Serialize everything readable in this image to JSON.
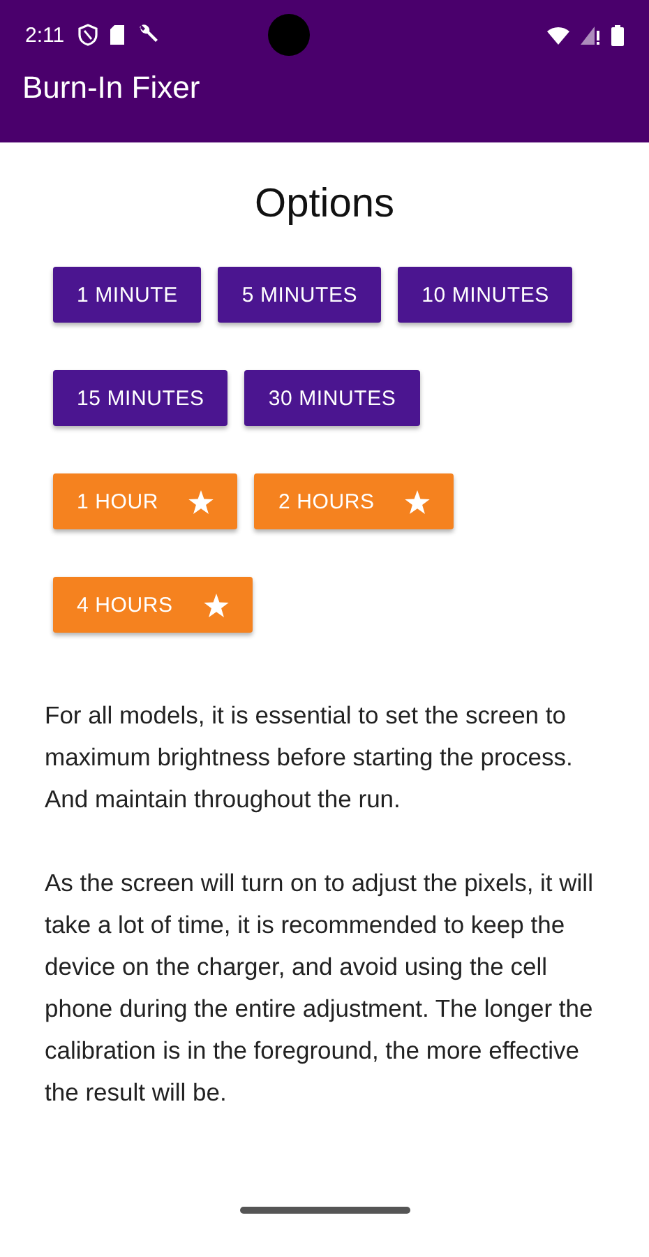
{
  "status_bar": {
    "time": "2:11"
  },
  "app_bar": {
    "title": "Burn-In Fixer"
  },
  "heading": "Options",
  "buttons": [
    {
      "label": "1 MINUTE",
      "kind": "standard"
    },
    {
      "label": "5 MINUTES",
      "kind": "standard"
    },
    {
      "label": "10 MINUTES",
      "kind": "standard"
    },
    {
      "label": "15 MINUTES",
      "kind": "standard"
    },
    {
      "label": "30 MINUTES",
      "kind": "standard"
    },
    {
      "label": "1 HOUR",
      "kind": "premium"
    },
    {
      "label": "2 HOURS",
      "kind": "premium"
    },
    {
      "label": "4 HOURS",
      "kind": "premium"
    }
  ],
  "paragraphs": [
    "For all models, it is essential to set the screen to maximum brightness before starting the process. And maintain throughout the run.",
    "As the screen will turn on to adjust the pixels, it will take a lot of time, it is recommended to keep the device on the charger, and avoid using the cell phone during the entire adjustment. The longer the calibration is in the foreground, the more effective the result will be."
  ]
}
